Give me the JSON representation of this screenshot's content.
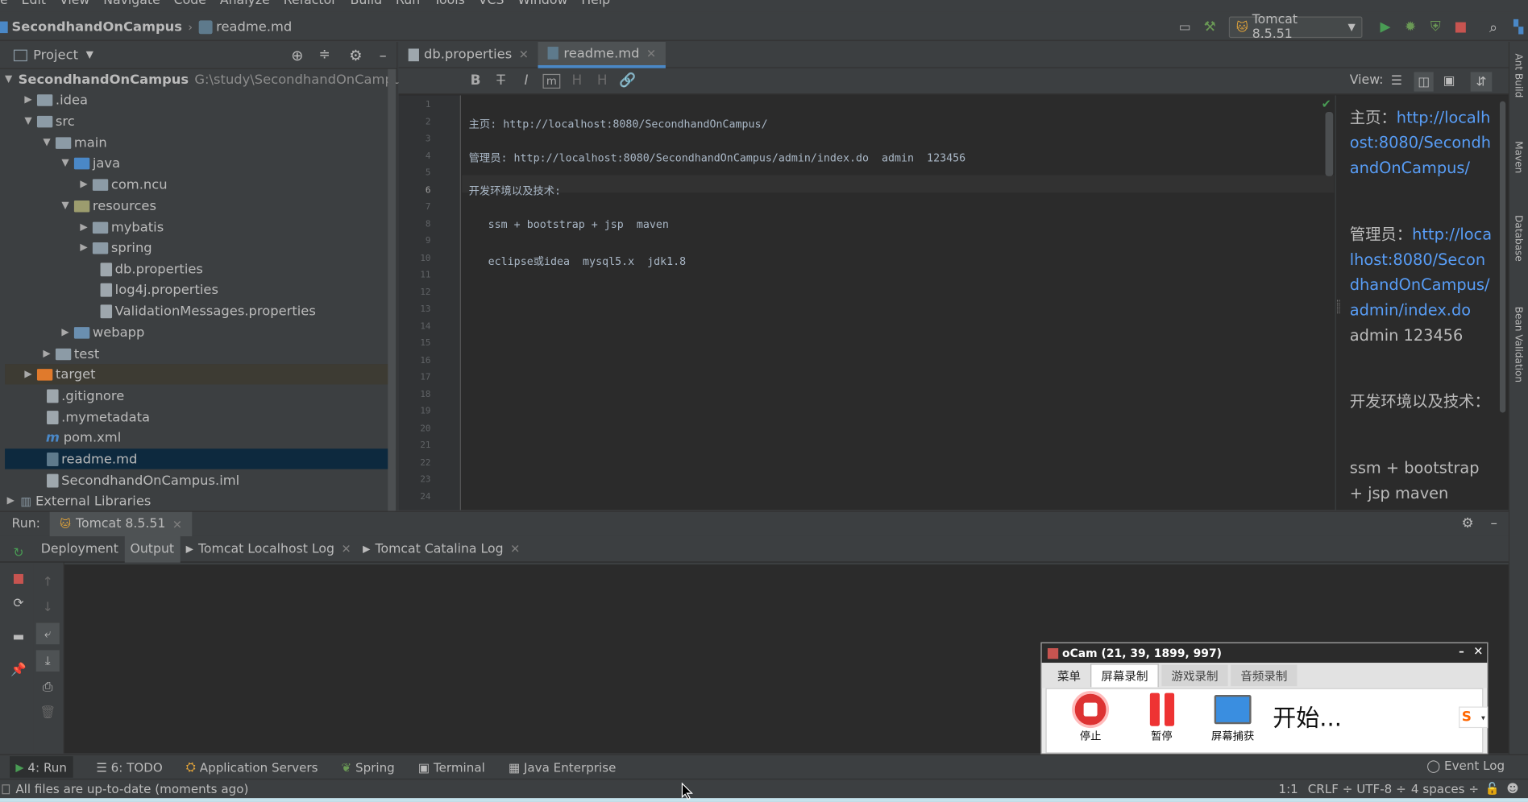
{
  "menu": [
    "e",
    "Edit",
    "View",
    "Navigate",
    "Code",
    "Analyze",
    "Refactor",
    "Build",
    "Run",
    "Tools",
    "VCS",
    "Window",
    "Help"
  ],
  "breadcrumb": {
    "project": "SecondhandOnCampus",
    "file": "readme.md"
  },
  "runconfig": {
    "label": "Tomcat 8.5.51"
  },
  "project_panel": {
    "title": "Project",
    "tree": [
      {
        "label": "SecondhandOnCampus",
        "path": "G:\\study\\SecondhandOnCampus"
      },
      {
        "label": ".idea"
      },
      {
        "label": "src"
      },
      {
        "label": "main"
      },
      {
        "label": "java"
      },
      {
        "label": "com.ncu"
      },
      {
        "label": "resources"
      },
      {
        "label": "mybatis"
      },
      {
        "label": "spring"
      },
      {
        "label": "db.properties"
      },
      {
        "label": "log4j.properties"
      },
      {
        "label": "ValidationMessages.properties"
      },
      {
        "label": "webapp"
      },
      {
        "label": "test"
      },
      {
        "label": "target"
      },
      {
        "label": ".gitignore"
      },
      {
        "label": ".mymetadata"
      },
      {
        "label": "pom.xml"
      },
      {
        "label": "readme.md"
      },
      {
        "label": "SecondhandOnCampus.iml"
      },
      {
        "label": "External Libraries"
      }
    ]
  },
  "editor": {
    "tabs": [
      {
        "label": "db.properties"
      },
      {
        "label": "readme.md"
      }
    ],
    "view_label": "View:",
    "toolbar": [
      "B",
      "T",
      "I",
      "m",
      "H",
      "H",
      "link"
    ],
    "line_numbers": [
      "1",
      "2",
      "3",
      "4",
      "5",
      "6",
      "7",
      "8",
      "9",
      "10",
      "11",
      "12",
      "13",
      "14",
      "15",
      "16",
      "17",
      "18",
      "19",
      "20",
      "21",
      "22",
      "23",
      "24"
    ],
    "code": [
      {
        "line": 2,
        "text": "主页: http://localhost:8080/SecondhandOnCampus/"
      },
      {
        "line": 4,
        "text": "管理员: http://localhost:8080/SecondhandOnCampus/admin/index.do  admin  123456"
      },
      {
        "line": 6,
        "text": "开发环境以及技术:"
      },
      {
        "line": 8,
        "text": "   ssm + bootstrap + jsp  maven"
      },
      {
        "line": 10,
        "text": "   eclipse或idea  mysql5.x  jdk1.8"
      }
    ],
    "preview": {
      "p1_label": "主页：",
      "p1_link": "http://localhost:8080/SecondhandOnCampus/",
      "p2_label": "管理员：",
      "p2_link": "http://localhost:8080/SecondhandOnCampus/admin/index.do",
      "p2_rest": " admin 123456",
      "p3": "开发环境以及技术：",
      "p4": "ssm + bootstrap + jsp maven"
    }
  },
  "right_strip": [
    "Ant Build",
    "Maven",
    "Database",
    "Bean Validation"
  ],
  "run_panel": {
    "run_label": "Run:",
    "config_tab": "Tomcat 8.5.51",
    "tabs": [
      {
        "label": "Deployment"
      },
      {
        "label": "Output"
      },
      {
        "label": "Tomcat Localhost Log"
      },
      {
        "label": "Tomcat Catalina Log"
      }
    ]
  },
  "tool_windows": [
    {
      "label": "4: Run"
    },
    {
      "label": "6: TODO"
    },
    {
      "label": "Application Servers"
    },
    {
      "label": "Spring"
    },
    {
      "label": "Terminal"
    },
    {
      "label": "Java Enterprise"
    }
  ],
  "event_log": "Event Log",
  "status": {
    "message": "All files are up-to-date (moments ago)",
    "position": "1:1",
    "line_sep": "CRLF ÷",
    "encoding": "UTF-8 ÷",
    "indent": "4 spaces ÷"
  },
  "ocam": {
    "title": "oCam (21, 39, 1899, 997)",
    "tabs": [
      "菜单",
      "屏幕录制",
      "游戏录制",
      "音频录制"
    ],
    "buttons": [
      {
        "label": "停止"
      },
      {
        "label": "暂停"
      },
      {
        "label": "屏幕捕获"
      }
    ],
    "status": "开始..."
  },
  "colors": {
    "accent": "#4a88c7",
    "link": "#589df6",
    "selected": "#0d293e",
    "run_green": "#499c54",
    "stop_red": "#c75450"
  }
}
